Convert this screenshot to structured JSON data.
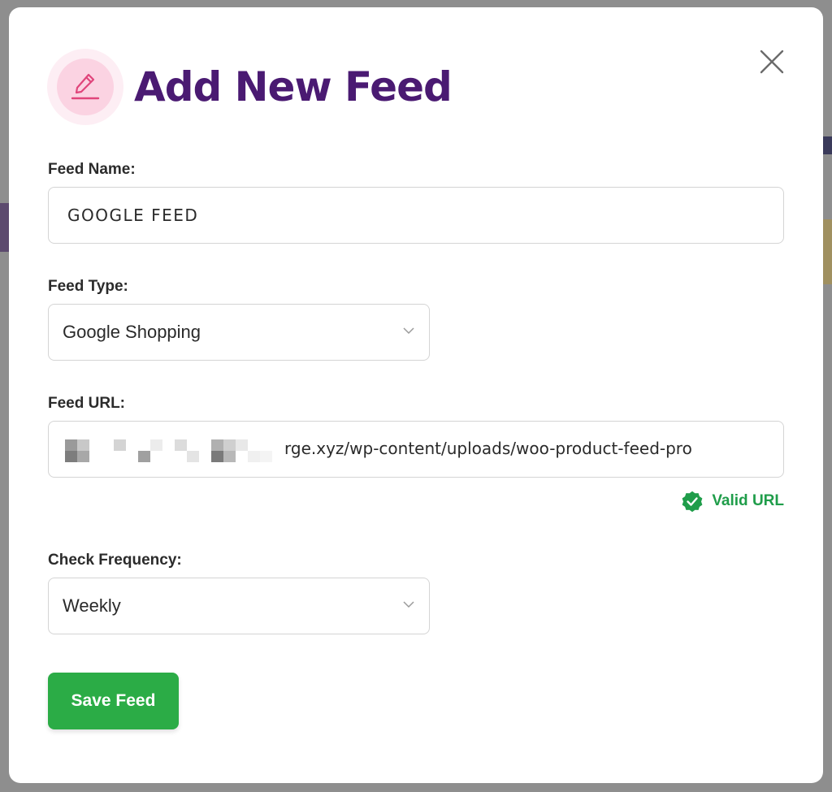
{
  "modal": {
    "title": "Add New Feed",
    "close_icon": "close-icon",
    "title_icon": "pencil-edit-icon"
  },
  "form": {
    "feed_name": {
      "label": "Feed Name:",
      "value": "GOOGLE FEED"
    },
    "feed_type": {
      "label": "Feed Type:",
      "selected": "Google Shopping",
      "icon": "chevron-down-icon"
    },
    "feed_url": {
      "label": "Feed URL:",
      "value_visible": "rge.xyz/wp-content/uploads/woo-product-feed-pro",
      "validation_text": "Valid URL",
      "validation_icon": "check-badge-icon"
    },
    "check_frequency": {
      "label": "Check Frequency:",
      "selected": "Weekly",
      "icon": "chevron-down-icon"
    }
  },
  "actions": {
    "save_label": "Save Feed"
  },
  "colors": {
    "title": "#4a1a72",
    "accent_pink": "#e0457b",
    "valid_green": "#1f9d4a",
    "save_button": "#2bac46",
    "overlay": "#8e8e8e"
  }
}
